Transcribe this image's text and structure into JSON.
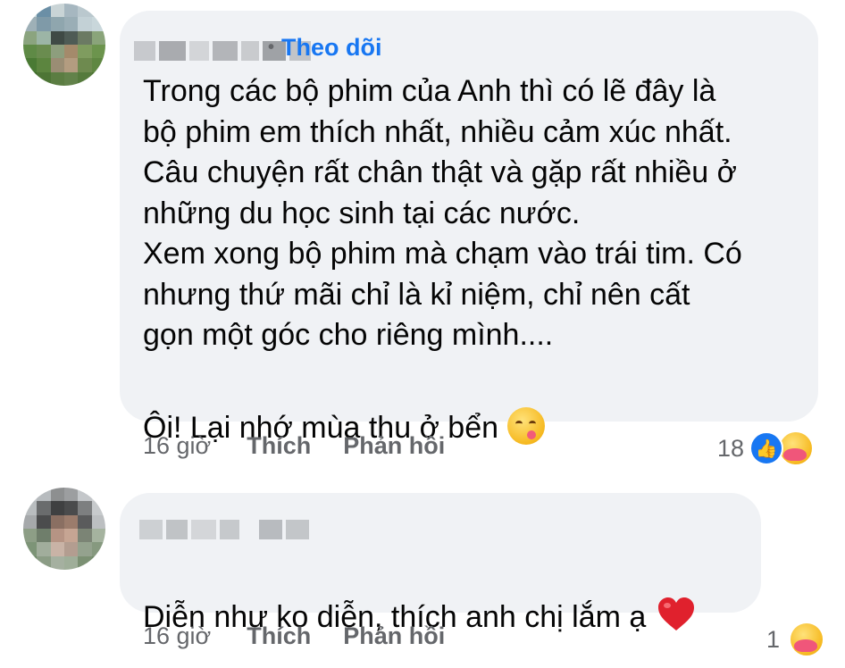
{
  "comments": [
    {
      "follow_label": "Theo dõi",
      "text": "Trong các bộ phim của Anh thì có lẽ đây là\nbộ phim em thích nhất, nhiều cảm xúc nhất.\nCâu chuyện rất chân thật và gặp rất nhiều ở\nnhững du học sinh tại các nước.\nXem xong bộ phim mà chạm vào trái tim. Có\nnhưng thứ mãi chỉ là kỉ niệm, chỉ nên cất\ngọn một góc cho riêng mình....",
      "text_last": "Ôi! Lại nhớ mùa thu ở bển",
      "emoji": "yum-face-icon",
      "time": "16 giờ",
      "like_label": "Thích",
      "reply_label": "Phản hồi",
      "reaction_count": "18",
      "reactions": [
        "like-icon",
        "care-icon"
      ]
    },
    {
      "text": "Diễn như ko diễn, thích anh chị lắm ạ",
      "emoji": "heart-icon",
      "time": "16 giờ",
      "like_label": "Thích",
      "reply_label": "Phản hồi",
      "reaction_count": "1",
      "reactions": [
        "care-icon"
      ]
    }
  ],
  "colors": {
    "bubble": "#f0f2f5",
    "accent": "#1877f2",
    "meta": "#65676b",
    "text": "#050505"
  }
}
